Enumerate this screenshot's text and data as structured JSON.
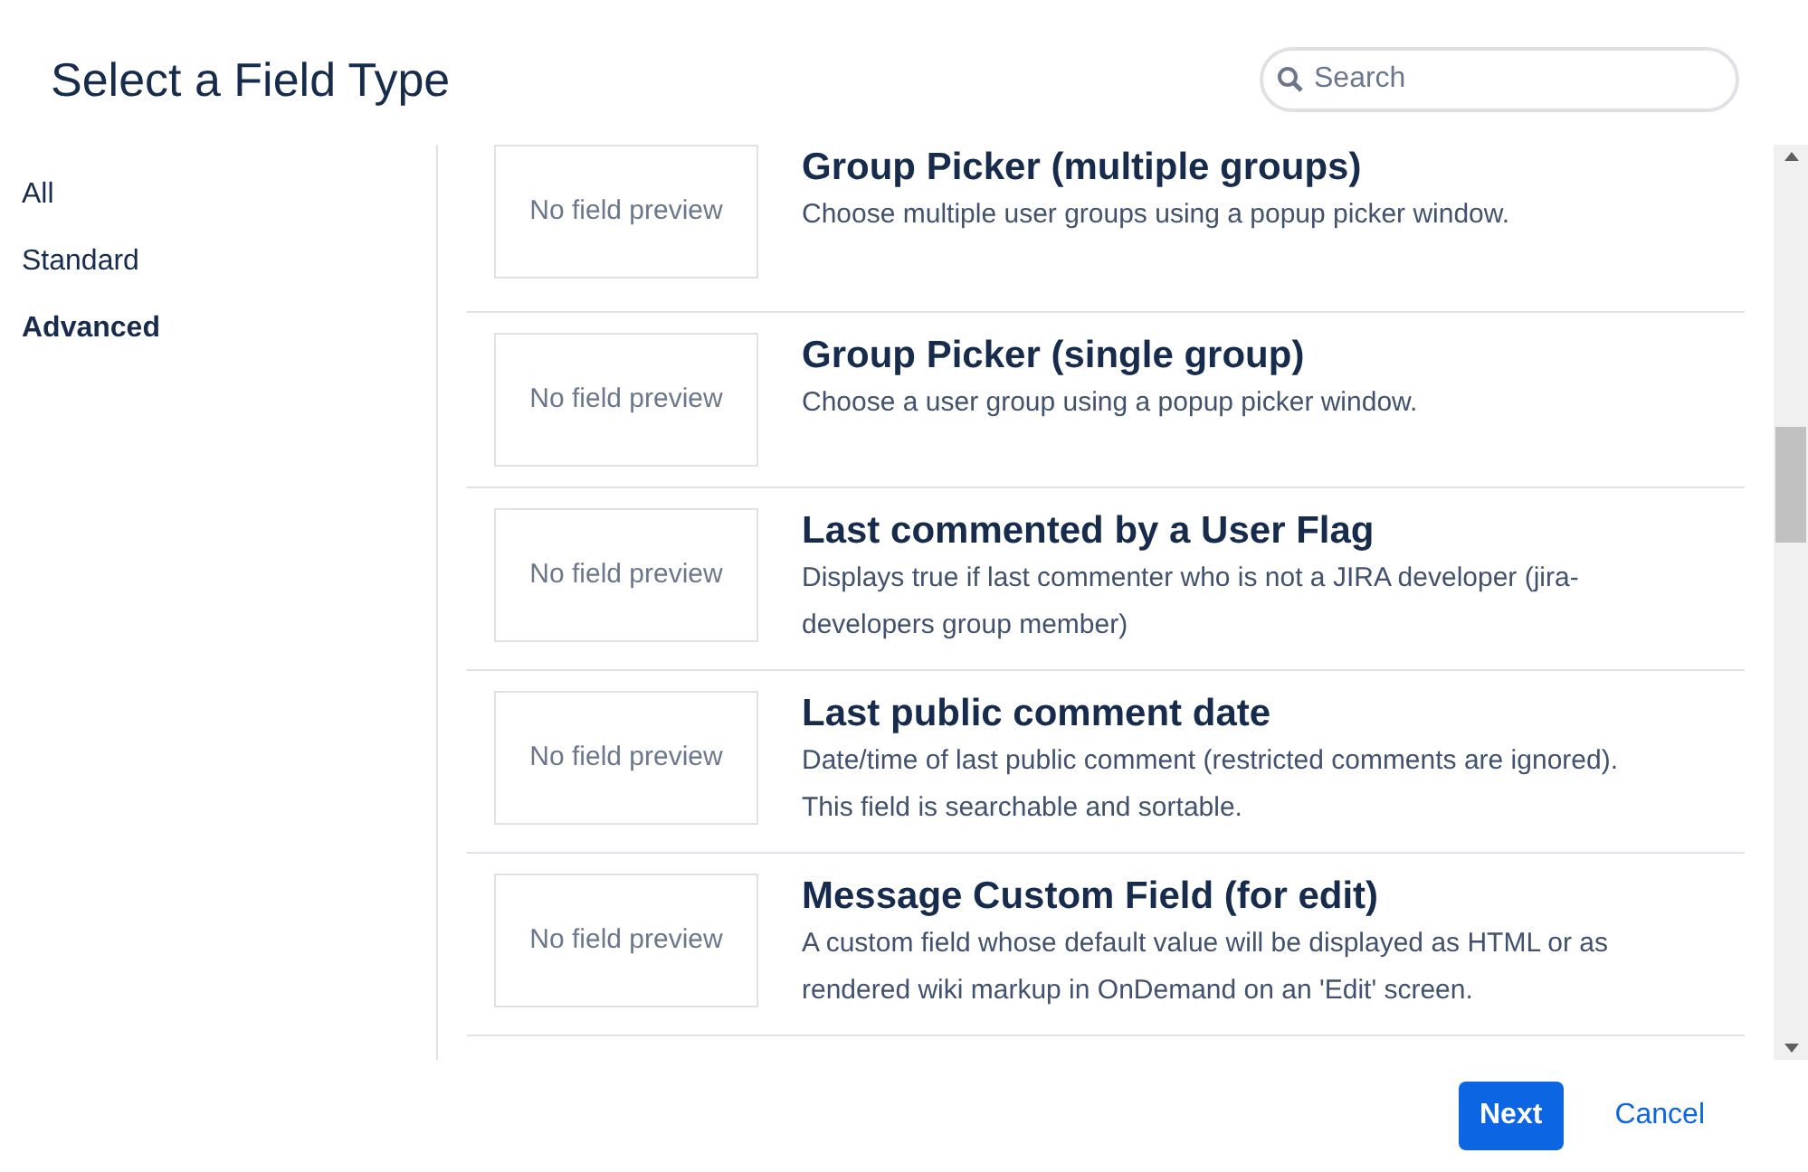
{
  "title": "Select a Field Type",
  "search": {
    "placeholder": "Search"
  },
  "sidebar": {
    "items": [
      {
        "label": "All",
        "selected": false
      },
      {
        "label": "Standard",
        "selected": false
      },
      {
        "label": "Advanced",
        "selected": true
      }
    ]
  },
  "fields": [
    {
      "preview": "No field preview",
      "name": "Group Picker (multiple groups)",
      "description": "Choose multiple user groups using a popup picker window."
    },
    {
      "preview": "No field preview",
      "name": "Group Picker (single group)",
      "description": "Choose a user group using a popup picker window."
    },
    {
      "preview": "No field preview",
      "name": "Last commented by a User Flag",
      "description": "Displays true if last commenter who is not a JIRA developer (jira-developers group member)"
    },
    {
      "preview": "No field preview",
      "name": "Last public comment date",
      "description": "Date/time of last public comment (restricted comments are ignored). This field is searchable and sortable."
    },
    {
      "preview": "No field preview",
      "name": "Message Custom Field (for edit)",
      "description": "A custom field whose default value will be displayed as HTML or as rendered wiki markup in OnDemand on an 'Edit' screen."
    }
  ],
  "buttons": [
    {
      "label": "Next",
      "kind": "primary"
    },
    {
      "label": "Cancel",
      "kind": "link"
    }
  ]
}
